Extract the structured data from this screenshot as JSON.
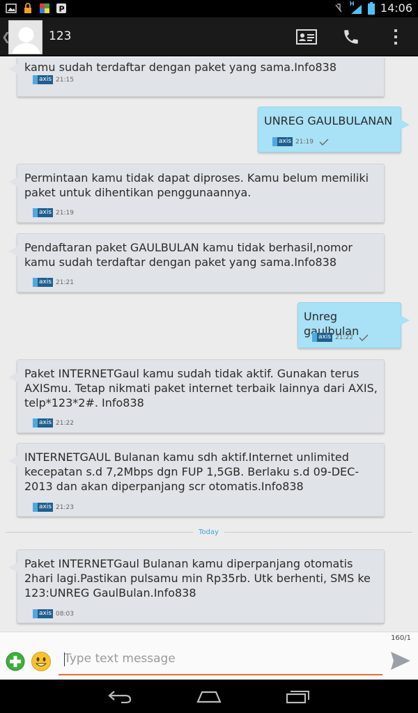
{
  "status_bar": {
    "time": "14:06",
    "network": "H"
  },
  "header": {
    "contact_name": "123"
  },
  "messages": [
    {
      "direction": "in",
      "text": "kamu sudah terdaftar dengan paket yang sama.Info838",
      "sim": "axis",
      "time": "21:15"
    },
    {
      "direction": "out",
      "text": "UNREG GAULBULANAN",
      "sim": "axis",
      "time": "21:19"
    },
    {
      "direction": "in",
      "text": "Permintaan kamu tidak dapat diproses. Kamu belum memiliki paket untuk dihentikan penggunaannya.",
      "sim": "axis",
      "time": "21:19"
    },
    {
      "direction": "in",
      "text": "Pendaftaran paket GAULBULAN kamu tidak berhasil,nomor kamu sudah terdaftar dengan paket yang sama.Info838",
      "sim": "axis",
      "time": "21:21"
    },
    {
      "direction": "out",
      "text": "Unreg gaulbulan",
      "sim": "axis",
      "time": "21:22"
    },
    {
      "direction": "in",
      "text": "Paket INTERNETGaul kamu sudah tidak aktif. Gunakan terus AXISmu. Tetap nikmati paket internet terbaik lainnya dari AXIS, telp*123*2#. Info838",
      "sim": "axis",
      "time": "21:22"
    },
    {
      "direction": "in",
      "text": "INTERNETGAUL Bulanan kamu sdh aktif.Internet unlimited kecepatan s.d 7,2Mbps dgn FUP 1,5GB. Berlaku s.d 09-DEC-2013 dan akan diperpanjang scr otomatis.Info838",
      "sim": "axis",
      "time": "21:23"
    },
    {
      "direction": "in",
      "text": "Paket INTERNETGaul Bulanan kamu diperpanjang otomatis 2hari lagi.Pastikan pulsamu min Rp35rb. Utk berhenti, SMS ke 123:UNREG GaulBulan.Info838",
      "sim": "axis",
      "time": "08:03"
    }
  ],
  "divider_label": "Today",
  "compose": {
    "counter": "160/1",
    "placeholder": "Type text message"
  },
  "colors": {
    "incoming_bubble": "#e0e3e7",
    "outgoing_bubble": "#a9e1f6",
    "accent": "#e3712b",
    "divider_text": "#3ca3d6"
  }
}
